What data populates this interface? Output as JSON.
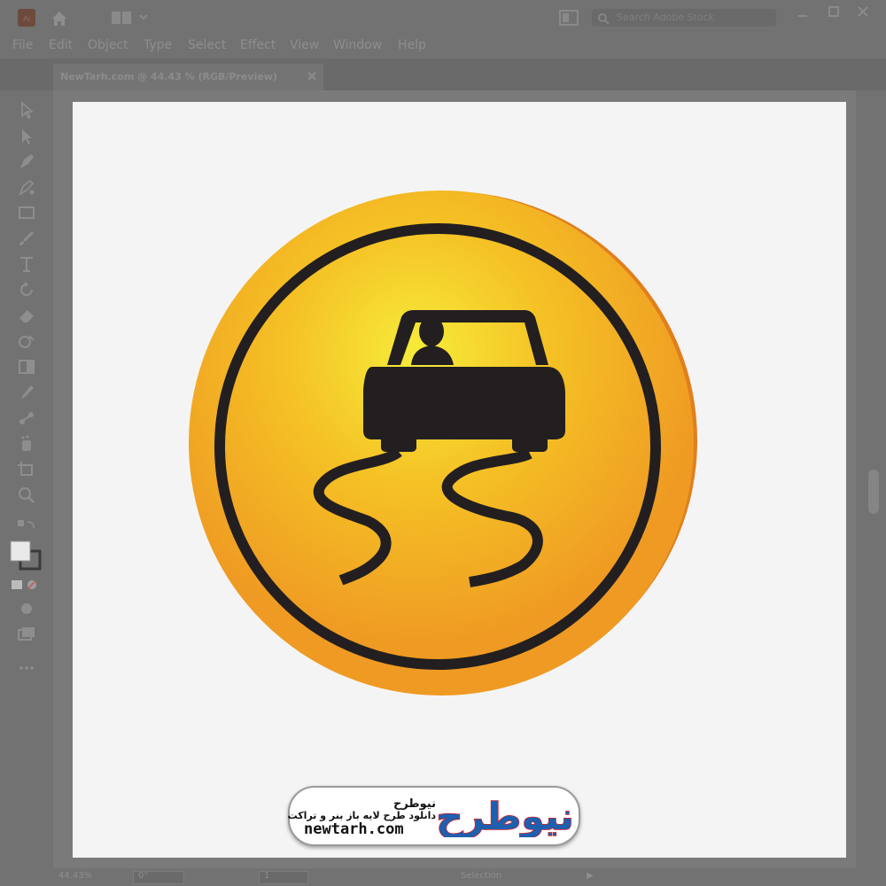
{
  "app": {
    "name": "Adobe Illustrator"
  },
  "menu": [
    "File",
    "Edit",
    "Object",
    "Type",
    "Select",
    "Effect",
    "View",
    "Window",
    "Help"
  ],
  "document_tab": {
    "label": "NewTarh.com @ 44.43 % (RGB/Preview)"
  },
  "search": {
    "placeholder": "Search Adobe Stock"
  },
  "status_bar": {
    "zoom": "44.43%",
    "rotation": "0°",
    "artboard": "1",
    "mode": "Selection"
  },
  "artwork": {
    "subject": "slippery road warning sign",
    "colors": {
      "face_center": "#f6ec3a",
      "face_mid": "#f5c125",
      "face_edge": "#ef9a23",
      "rim": "#e07f1c",
      "ink": "#231f20",
      "artboard": "#f4f4f4"
    }
  },
  "watermark": {
    "brand_fa": "نیوطرح",
    "tagline_fa": "دانلود طرح لایه باز بنر و تراکت",
    "url": "newtarh.com",
    "logo_text_fa": "نیوطرح",
    "logo_colors": {
      "blue": "#1e5fae",
      "red": "#e11f26"
    }
  }
}
